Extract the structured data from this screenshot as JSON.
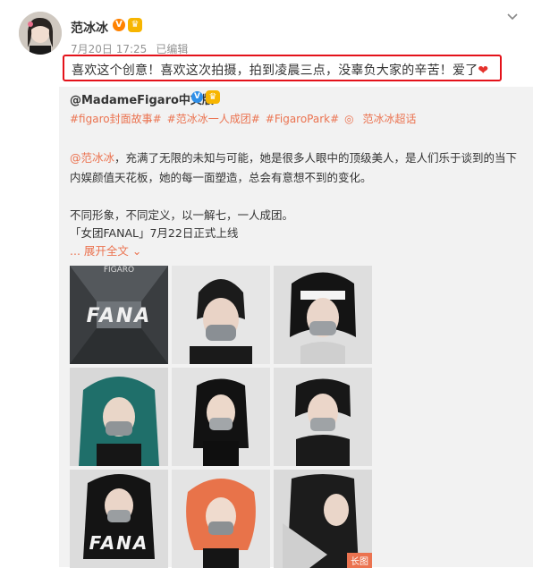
{
  "post": {
    "author_name": "范冰冰",
    "verified_mark": "V",
    "meta": {
      "date": "7月20日 17:25",
      "edited": "已编辑"
    },
    "text": "喜欢这个创意！喜欢这次拍摄，拍到凌晨三点，没辜负大家的辛苦！爱了",
    "heart": "❤"
  },
  "repost": {
    "author": "@MadameFigaro中文版",
    "verified_mark": "V",
    "tags": [
      "#figaro封面故事#",
      "#范冰冰一人成团#",
      "#FigaroPark#",
      "范冰冰超话"
    ],
    "mention": "@范冰冰",
    "body": "，充满了无限的未知与可能，她是很多人眼中的顶级美人，是人们乐于谈到的当下内娱颜值天花板，她的每一面塑造，总会有意想不到的变化。",
    "line2": "不同形象，不同定义，以一解七，一人成团。",
    "line3": "「女团FANAL」7月22日正式上线",
    "expand_label": "... 展开全文",
    "expand_arrow": "⌄",
    "long_image_tag": "长图"
  },
  "images": [
    {
      "cover_text": "FIGARO",
      "logo": "FANA"
    },
    {
      "cover_text": "",
      "logo": ""
    },
    {
      "cover_text": "",
      "logo": ""
    },
    {
      "cover_text": "",
      "logo": ""
    },
    {
      "cover_text": "",
      "logo": ""
    },
    {
      "cover_text": "",
      "logo": ""
    },
    {
      "cover_text": "",
      "logo": "FANA"
    },
    {
      "cover_text": "",
      "logo": ""
    },
    {
      "cover_text": "",
      "logo": ""
    }
  ],
  "icons": {
    "more": "chevron-down-icon",
    "vip": "vip-badge-icon",
    "crown": "crown-icon",
    "super_topic": "super-topic-icon"
  },
  "colors": {
    "accent": "#eb7350",
    "highlight_border": "#e4121a",
    "repost_bg": "#f2f2f2",
    "verified": "#ff8200"
  }
}
